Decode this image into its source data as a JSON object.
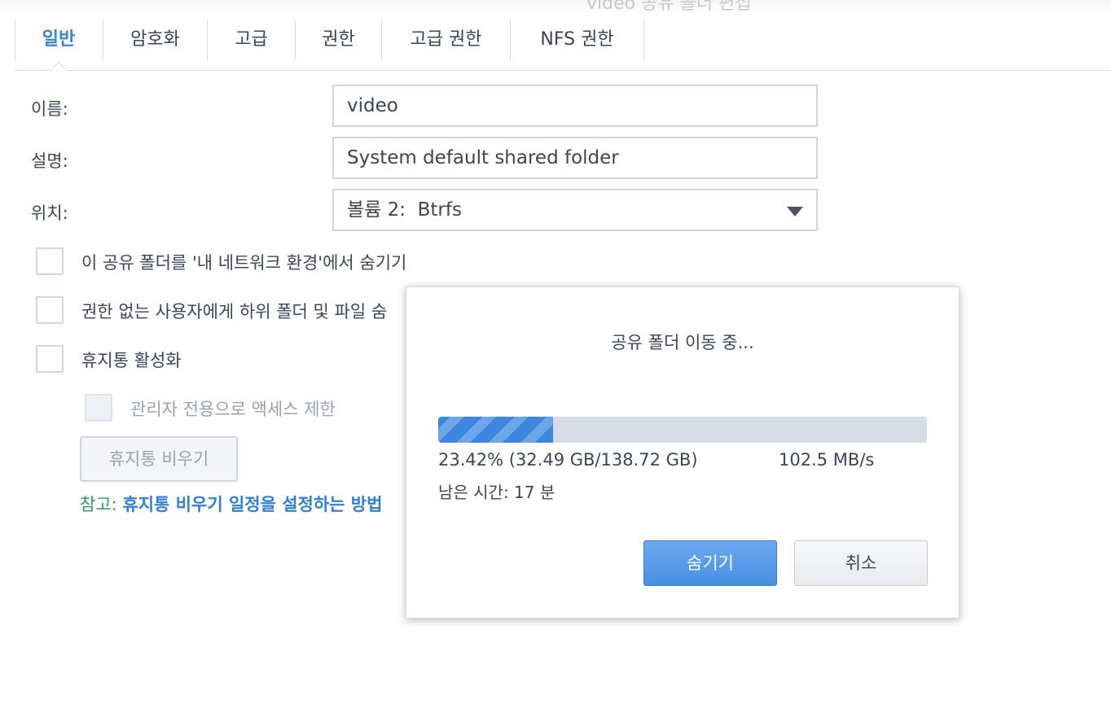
{
  "window": {
    "title": "video 공유 폴더 편집"
  },
  "tabs": [
    {
      "label": "일반",
      "active": true
    },
    {
      "label": "암호화"
    },
    {
      "label": "고급"
    },
    {
      "label": "권한"
    },
    {
      "label": "고급 권한"
    },
    {
      "label": "NFS 권한"
    }
  ],
  "form": {
    "name_label": "이름:",
    "name_value": "video",
    "description_label": "설명:",
    "description_value": "System default shared folder",
    "location_label": "위치:",
    "location_value": "볼륨 2:  Btrfs"
  },
  "options": {
    "hide_in_network": {
      "label": "이 공유 폴더를 '내 네트워크 환경'에서 숨기기",
      "checked": false
    },
    "hide_subfolders": {
      "label": "권한 없는 사용자에게 하위 폴더 및 파일 숨",
      "checked": false
    },
    "recycle_bin": {
      "label": "휴지통 활성화",
      "checked": false
    },
    "admin_only": {
      "label": "관리자 전용으로 액세스 제한",
      "checked": false,
      "disabled": true
    },
    "empty_trash_button": "휴지통 비우기"
  },
  "note": {
    "prefix": "참고:",
    "link": "휴지통 비우기 일정을 설정하는 방법"
  },
  "dialog": {
    "title": "공유 폴더 이동 중...",
    "progress_fraction": 0.2342,
    "progress_text": "23.42% (32.49 GB/138.72 GB)",
    "speed": "102.5 MB/s",
    "remaining": "남은 시간: 17 분",
    "hide_button": "숨기기",
    "cancel_button": "취소"
  },
  "colors": {
    "accent": "#3b83d6",
    "note_green": "#2e9d5b",
    "progress": "#3f86dd"
  }
}
